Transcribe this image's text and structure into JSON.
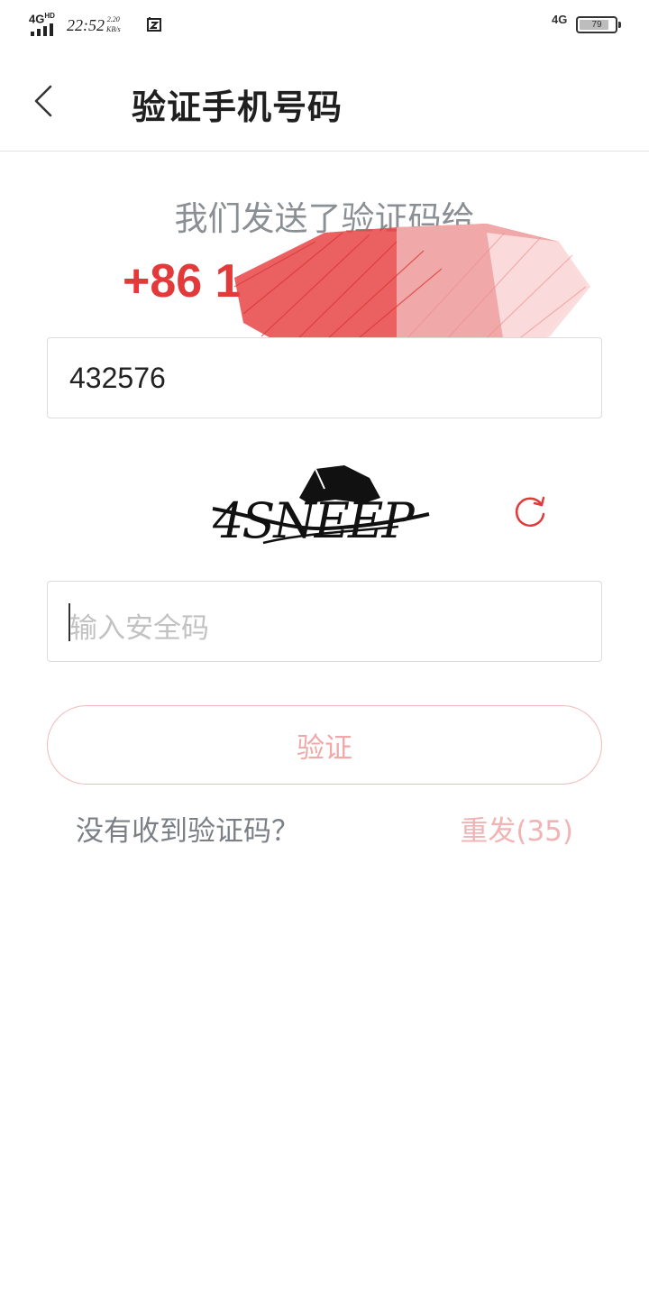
{
  "status_bar": {
    "network": "4G",
    "network_sup": "HD",
    "time": "22:52",
    "speed_value": "2.20",
    "speed_unit": "KB/s",
    "mobile_data": "4G",
    "battery": "79"
  },
  "header": {
    "back_icon": "chevron-left-icon",
    "title": "验证手机号码"
  },
  "main": {
    "sent_text": "我们发送了验证码给",
    "phone_prefix": "+86 1",
    "code_value": "432576",
    "captcha_text": "4SNEEP",
    "refresh_icon": "refresh-icon",
    "secure_placeholder": "输入安全码",
    "verify_label": "验证",
    "no_code_text": "没有收到验证码？",
    "resend_label": "重发(35)"
  },
  "colors": {
    "accent": "#e23a3a",
    "accent_light": "#f0a8a8",
    "text_gray": "#8a8f94"
  }
}
